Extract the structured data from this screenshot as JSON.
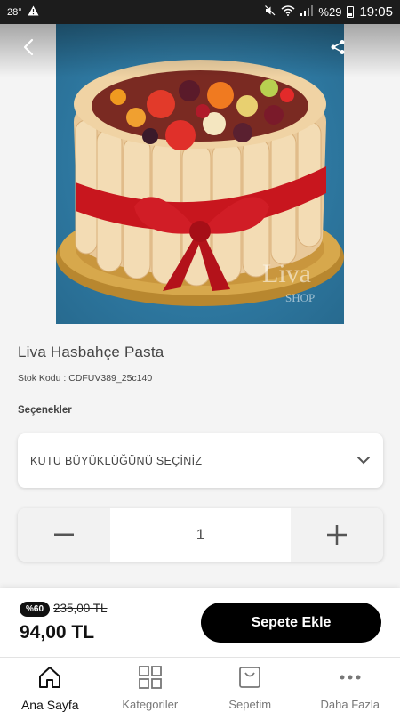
{
  "status_bar": {
    "temperature": "28°",
    "battery": "%29",
    "time": "19:05"
  },
  "hero": {
    "watermark": "Liva SHOP"
  },
  "product": {
    "title": "Liva Hasbahçe Pasta",
    "stock_code": "Stok Kodu : CDFUV389_25c140"
  },
  "options": {
    "label": "Seçenekler",
    "select_placeholder": "KUTU BÜYÜKLÜĞÜNÜ SEÇİNİZ"
  },
  "quantity": {
    "value": "1"
  },
  "purchase": {
    "discount_badge": "%60",
    "old_price": "235,00 TL",
    "new_price": "94,00 TL",
    "add_to_cart_label": "Sepete Ekle"
  },
  "nav": {
    "items": [
      {
        "label": "Ana Sayfa",
        "icon": "home-icon",
        "active": true
      },
      {
        "label": "Kategoriler",
        "icon": "grid-icon",
        "active": false
      },
      {
        "label": "Sepetim",
        "icon": "basket-icon",
        "active": false
      },
      {
        "label": "Daha Fazla",
        "icon": "more-icon",
        "active": false
      }
    ]
  },
  "colors": {
    "accent": "#000000",
    "background": "#f4f4f4",
    "image_bg": "#2f7aa3",
    "ribbon": "#c8161e"
  }
}
